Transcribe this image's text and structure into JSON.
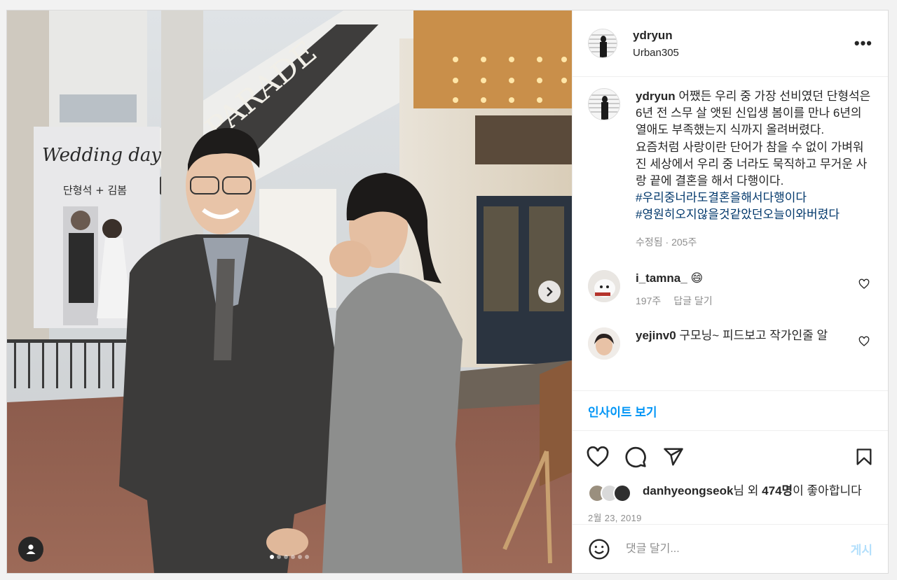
{
  "post": {
    "username": "ydryun",
    "location": "Urban305",
    "more_label": "•••",
    "carousel": {
      "slide_count": 6,
      "active_index": 0
    }
  },
  "caption": {
    "username": "ydryun",
    "lines": [
      "어쨌든 우리 중 가장 선비였던 단형석은 6년 전 스무 살 앳된 신입생 봄이를 만나 6년의 열애도 부족했는지 식까지 올려버렸다.",
      "요즘처럼 사랑이란 단어가 참을 수 없이 가벼워진 세상에서 우리 중 너라도 묵직하고 무거운 사랑 끝에 결혼을 해서 다행이다."
    ],
    "hashtags": [
      "#우리중너라도결혼을해서다행이다",
      "#영원히오지않을것같았던오늘이와버렸다"
    ],
    "meta": "수정됨 · 205주"
  },
  "comments": [
    {
      "username": "i_tamna_",
      "text": "😄",
      "age": "197주",
      "reply": "답글 달기"
    },
    {
      "username": "yejinv0",
      "text": "구모닝~ 피드보고 작가인줄 알",
      "age": "",
      "reply": ""
    }
  ],
  "insights_label": "인사이트 보기",
  "likes": {
    "user": "danhyeongseok",
    "suffix_1": "님 외 ",
    "count": "474명",
    "suffix_2": "이 좋아합니다"
  },
  "date": "2월 23, 2019",
  "comment_box": {
    "placeholder": "댓글 달기...",
    "post_label": "게시"
  },
  "banner": {
    "title": "Wedding day",
    "names": "단형석 + 김봄",
    "sign": "MA PARADE"
  }
}
